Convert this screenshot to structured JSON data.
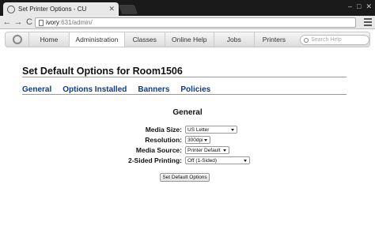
{
  "browser": {
    "tab_title": "Set Printer Options - CU",
    "url_host": "ivory",
    "url_rest": ":631/admin/"
  },
  "nav": {
    "tabs": [
      "Home",
      "Administration",
      "Classes",
      "Online Help",
      "Jobs",
      "Printers"
    ],
    "active": "Administration",
    "search_placeholder": "Search Help"
  },
  "page": {
    "title": "Set Default Options for Room1506",
    "subnav": [
      "General",
      "Options Installed",
      "Banners",
      "Policies"
    ],
    "section_title": "General"
  },
  "options": [
    {
      "label": "Media Size:",
      "value": "US Letter"
    },
    {
      "label": "Resolution:",
      "value": "300dpi"
    },
    {
      "label": "Media Source:",
      "value": "Printer Default"
    },
    {
      "label": "2-Sided Printing:",
      "value": "Off (1-Sided)"
    }
  ],
  "submit_label": "Set Default Options",
  "colors": {
    "link": "#0a3b8c",
    "chrome": "#1a1a1a"
  }
}
